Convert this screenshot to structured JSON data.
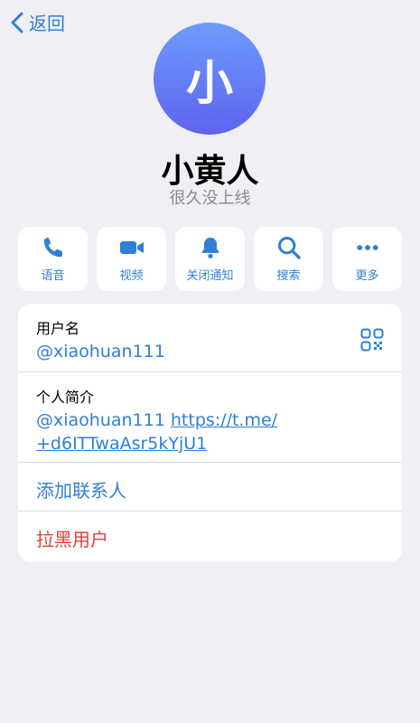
{
  "nav": {
    "back_label": "返回"
  },
  "profile": {
    "avatar_letter": "小",
    "name": "小黄人",
    "status": "很久没上线"
  },
  "actions": [
    {
      "label": "语音",
      "icon": "phone-icon"
    },
    {
      "label": "视频",
      "icon": "video-icon"
    },
    {
      "label": "关闭通知",
      "icon": "bell-icon"
    },
    {
      "label": "搜索",
      "icon": "search-icon"
    },
    {
      "label": "更多",
      "icon": "more-icon"
    }
  ],
  "info": {
    "username_label": "用户名",
    "username_value": "@xiaohuan111",
    "bio_label": "个人简介",
    "bio_handle": "@xiaohuan111",
    "bio_link_line1": "https://t.me/",
    "bio_link_line2": "+d6ITTwaAsr5kYjU1"
  },
  "menu": {
    "add_contact": "添加联系人",
    "block_user": "拉黑用户"
  },
  "colors": {
    "accent": "#2f7fd6",
    "danger": "#e0403c",
    "background": "#efeff4"
  }
}
